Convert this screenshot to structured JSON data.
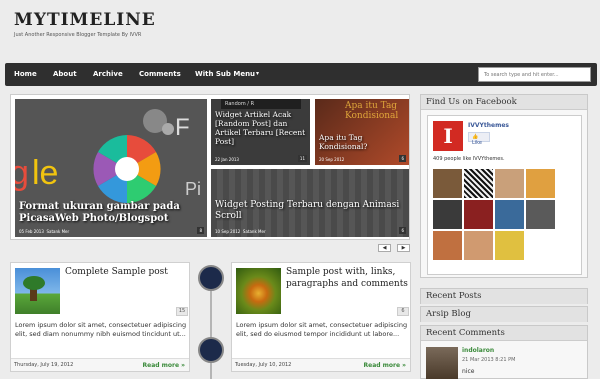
{
  "site": {
    "title": "MYTIMELINE",
    "tagline": "Just Another Responsive Blogger Template By IVVR"
  },
  "nav": {
    "items": [
      "Home",
      "About",
      "Archive",
      "Comments",
      "With Sub Menu"
    ],
    "submenu_caret": "▾",
    "search_placeholder": "To search type and hit enter..."
  },
  "slider": {
    "main": {
      "title": "Format ukuran gambar pada PicasaWeb Photo/Blogspot",
      "date": "05 Feb 2013",
      "author": "Satank Mer",
      "count": "8"
    },
    "s1": {
      "title": "Widget Artikel Acak [Random Post] dan Artikel Terbaru [Recent Post]",
      "date": "22 Jan 2013",
      "count": "11",
      "banner": "Random / R"
    },
    "s2": {
      "title": "Apa itu Tag Kondisional?",
      "date": "20 Sep 2012",
      "count": "6",
      "banner": "Apa itu Tag Kondisional"
    },
    "s3": {
      "title": "Widget Posting Terbaru dengan Animasi Scroll",
      "date": "10 Sep 2012",
      "author": "Satank Mer",
      "count": "6"
    },
    "prev": "◀",
    "next": "▶"
  },
  "posts": [
    {
      "title": "Complete Sample post",
      "count": "15",
      "excerpt": "Lorem ipsum dolor sit amet, consectetuer adipiscing elit, sed diam nonummy nibh euismod tincidunt ut...",
      "date": "Thursday, July 19, 2012",
      "more": "Read more »"
    },
    {
      "title": "Sample post with, links, paragraphs and comments",
      "count": "6",
      "excerpt": "Lorem ipsum dolor sit amet, consectetuer adipiscing elit, sed do eiusmod tempor incididunt ut labore...",
      "date": "Tuesday, July 10, 2012",
      "more": "Read more »"
    }
  ],
  "sidebar": {
    "facebook": {
      "heading": "Find Us on Facebook",
      "page_name": "IVVYthemes",
      "like": "Like",
      "likes_text": "409 people like IVVYthemes."
    },
    "recent_posts": "Recent Posts",
    "blog_archive": "Arsip Blog",
    "recent_comments": {
      "heading": "Recent Comments",
      "author": "indolaron",
      "date": "21 Mar 2013 8:21 PM",
      "text": "nice"
    }
  },
  "colors": {
    "navbar": "#2f2f2f",
    "accent_green": "#3a8a3a",
    "background": "#ececec"
  }
}
